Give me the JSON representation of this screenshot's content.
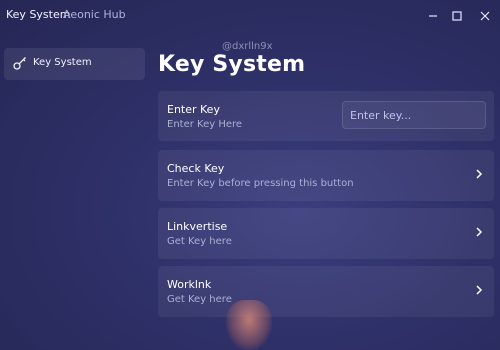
{
  "window": {
    "title": "Key System",
    "subtitle": "Aeonic Hub"
  },
  "watermark": "@dxrlln9x",
  "sidebar": {
    "items": [
      {
        "label": "Key System",
        "icon": "key-icon"
      }
    ]
  },
  "page": {
    "title": "Key System"
  },
  "cards": [
    {
      "title": "Enter Key",
      "desc": "Enter Key Here",
      "input_placeholder": "Enter key..."
    },
    {
      "title": "Check Key",
      "desc": "Enter Key before pressing this button",
      "icon": "chevron-right-icon"
    },
    {
      "title": "Linkvertise",
      "desc": "Get Key here",
      "icon": "chevron-right-icon"
    },
    {
      "title": "Worklnk",
      "desc": "Get Key here",
      "icon": "chevron-right-icon"
    }
  ],
  "colors": {
    "background": "#2e3068",
    "card": "#3a3c78",
    "muted_text": "#aab0d6"
  }
}
